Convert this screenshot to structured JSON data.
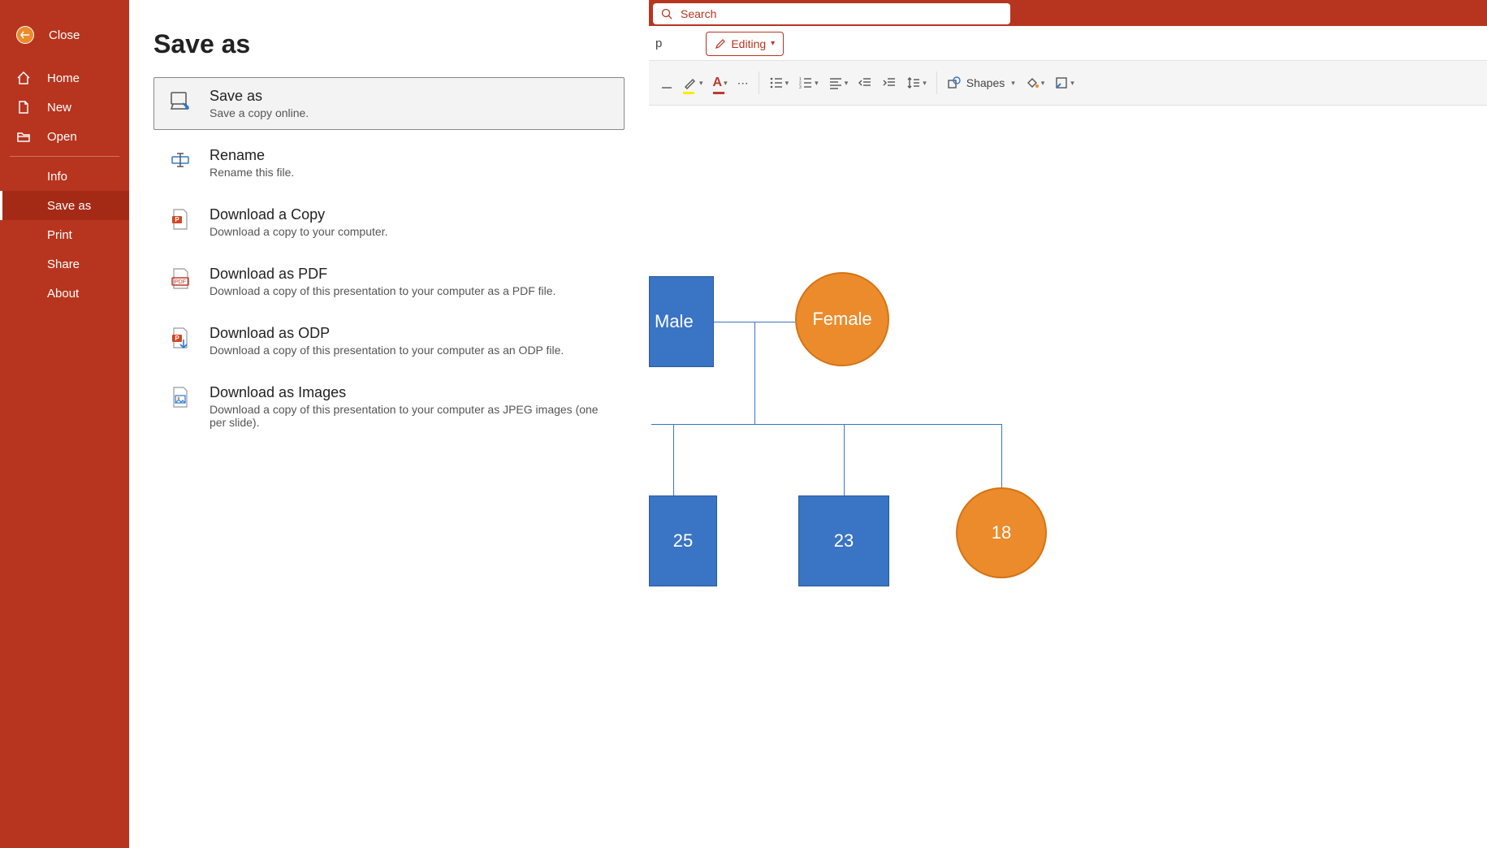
{
  "colors": {
    "brand": "#b7351f",
    "accent_blue": "#3a74c4",
    "accent_orange": "#ec8b2b"
  },
  "sidebar": {
    "close_label": "Close",
    "top_items": [
      {
        "label": "Home",
        "icon": "home-icon"
      },
      {
        "label": "New",
        "icon": "file-icon"
      },
      {
        "label": "Open",
        "icon": "folder-open-icon"
      }
    ],
    "sub_items": [
      {
        "label": "Info"
      },
      {
        "label": "Save as",
        "active": true
      },
      {
        "label": "Print"
      },
      {
        "label": "Share"
      },
      {
        "label": "About"
      }
    ]
  },
  "panel": {
    "heading": "Save as",
    "options": [
      {
        "title": "Save as",
        "desc": "Save a copy online.",
        "icon": "save-as-icon",
        "selected": true
      },
      {
        "title": "Rename",
        "desc": "Rename this file.",
        "icon": "rename-icon"
      },
      {
        "title": "Download a Copy",
        "desc": "Download a copy to your computer.",
        "icon": "pptx-icon"
      },
      {
        "title": "Download as PDF",
        "desc": "Download a copy of this presentation to your computer as a PDF file.",
        "icon": "pdf-icon"
      },
      {
        "title": "Download as ODP",
        "desc": "Download a copy of this presentation to your computer as an ODP file.",
        "icon": "odp-icon"
      },
      {
        "title": "Download as Images",
        "desc": "Download a copy of this presentation to your computer as JPEG images (one per slide).",
        "icon": "images-icon"
      }
    ]
  },
  "ribbon": {
    "partial_tab_char": "p",
    "editing_label": "Editing",
    "shapes_label": "Shapes",
    "more_glyph": "⋯"
  },
  "search": {
    "placeholder": "Search"
  },
  "slide_shapes": {
    "male": {
      "label": "Male"
    },
    "female": {
      "label": "Female"
    },
    "n25": {
      "label": "25"
    },
    "n23": {
      "label": "23"
    },
    "n18": {
      "label": "18"
    }
  }
}
